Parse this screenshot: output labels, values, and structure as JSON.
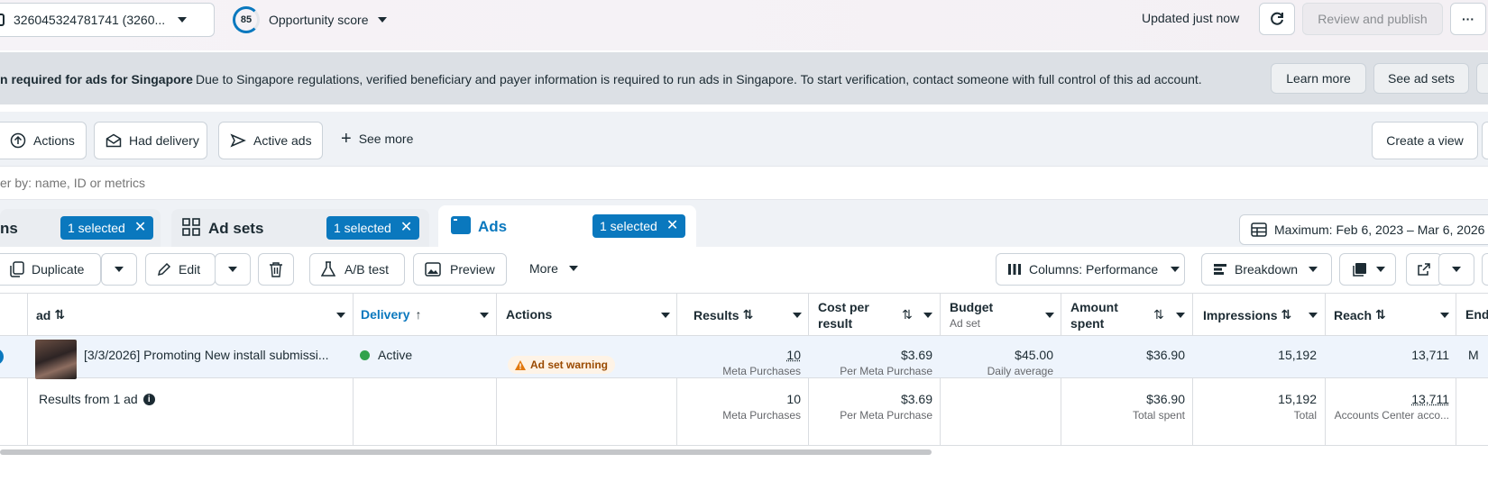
{
  "topbar": {
    "account_label": "326045324781741 (3260...",
    "score_value": "85",
    "score_label": "Opportunity score",
    "updated_text": "Updated just now",
    "review_publish_label": "Review and publish",
    "more_label": "···"
  },
  "banner": {
    "title": "n required for ads for Singapore",
    "message": "Due to Singapore regulations, verified beneficiary and payer information is required to run ads in Singapore. To start verification, contact someone with full control of this ad account.",
    "learn_more_label": "Learn more",
    "see_ad_sets_label": "See ad sets"
  },
  "filters": {
    "chips": [
      "Actions",
      "Had delivery",
      "Active ads"
    ],
    "see_more_label": "See more",
    "create_view_label": "Create a view",
    "search_placeholder": "er by: name, ID or metrics"
  },
  "levels": {
    "campaigns_label": "ns",
    "campaigns_selected": "1 selected",
    "adsets_label": "Ad sets",
    "adsets_selected": "1 selected",
    "ads_label": "Ads",
    "ads_selected": "1 selected",
    "date_range": "Maximum: Feb 6, 2023 – Mar 6, 2026"
  },
  "toolbar": {
    "duplicate_label": "Duplicate",
    "edit_label": "Edit",
    "ab_test_label": "A/B test",
    "preview_label": "Preview",
    "more_label": "More",
    "columns_label": "Columns: Performance",
    "breakdown_label": "Breakdown"
  },
  "table": {
    "headers": {
      "ad": "ad",
      "delivery": "Delivery",
      "actions": "Actions",
      "results": "Results",
      "cost_per_result_1": "Cost per",
      "cost_per_result_2": "result",
      "budget": "Budget",
      "budget_sub": "Ad set",
      "amount_spent_1": "Amount",
      "amount_spent_2": "spent",
      "impressions": "Impressions",
      "reach": "Reach",
      "ends": "End"
    },
    "row": {
      "ad_name": "[3/3/2026] Promoting New install submissi...",
      "delivery": "Active",
      "warning": "Ad set warning",
      "results": "10",
      "results_sub": "Meta Purchases",
      "cost": "$3.69",
      "cost_sub": "Per Meta Purchase",
      "budget": "$45.00",
      "budget_sub": "Daily average",
      "amount_spent": "$36.90",
      "impressions": "15,192",
      "reach": "13,711",
      "ends": "M"
    },
    "summary": {
      "label": "Results from 1 ad",
      "results": "10",
      "results_sub": "Meta Purchases",
      "cost": "$3.69",
      "cost_sub": "Per Meta Purchase",
      "amount_spent": "$36.90",
      "amount_sub": "Total spent",
      "impressions": "15,192",
      "impressions_sub": "Total",
      "reach": "13,711",
      "reach_sub": "Accounts Center acco..."
    }
  },
  "colors": {
    "accent": "#0a78be",
    "banner_bg": "#dce0e5",
    "active_dot": "#31a24c",
    "warning": "#e1780e"
  }
}
